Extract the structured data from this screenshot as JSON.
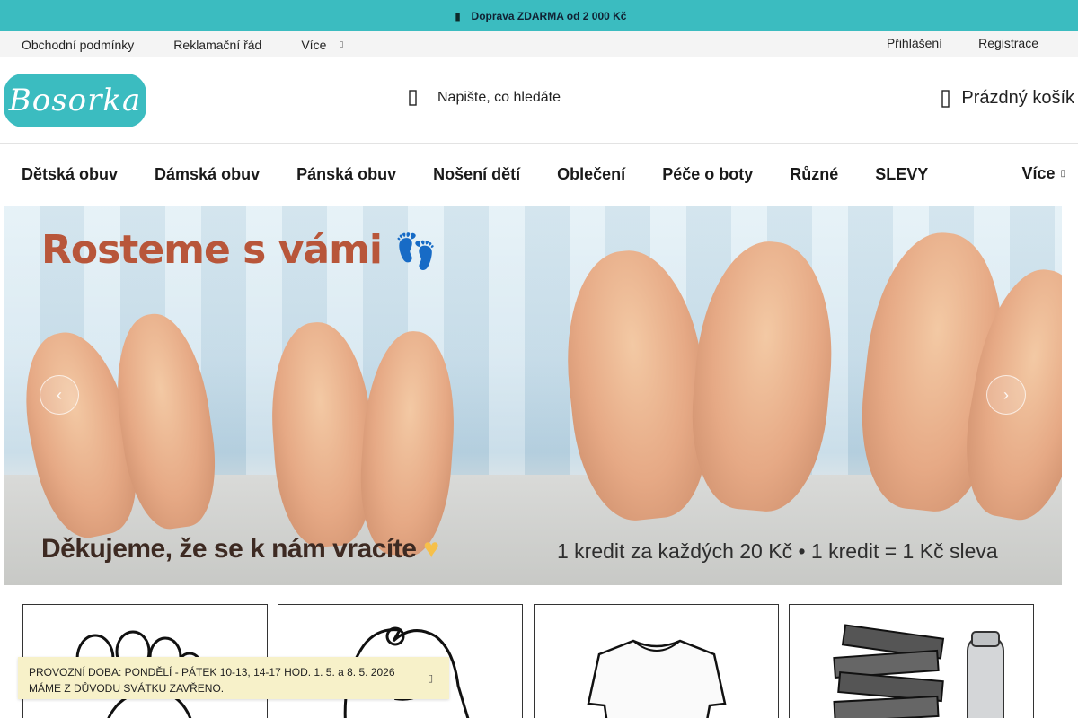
{
  "promo": {
    "text": "Doprava ZDARMA od 2 000 Kč",
    "icon": "truck-icon"
  },
  "utility": {
    "links": [
      "Obchodní podmínky",
      "Reklamační řád"
    ],
    "more_label": "Více",
    "login": "Přihlášení",
    "register": "Registrace"
  },
  "header": {
    "logo_text": "Bosorka",
    "search_label": "Napište, co hledáte",
    "cart_label": "Prázdný košík"
  },
  "categories": {
    "items": [
      "Dětská obuv",
      "Dámská obuv",
      "Pánská obuv",
      "Nošení dětí",
      "Oblečení",
      "Péče o boty",
      "Různé",
      "SLEVY"
    ],
    "more_label": "Více"
  },
  "hero": {
    "title": "Rosteme s vámi",
    "bottom_left": "Děkujeme, že se k nám vracíte",
    "bottom_right": "1 kredit za každých 20 Kč • 1 kredit = 1 Kč sleva"
  },
  "tiles": [
    "footprint-icon",
    "baby-carrier-icon",
    "tshirt-icon",
    "books-bottle-icon"
  ],
  "notice": {
    "line1": "PROVOZNÍ DOBA: PONDĚLÍ - PÁTEK 10-13, 14-17 HOD. 1. 5. a 8. 5. 2026",
    "line2": "MÁME Z DŮVODU SVÁTKU ZAVŘENO."
  },
  "colors": {
    "brand": "#3bbcc0",
    "notice_bg": "#f7f1c9",
    "hero_title": "#b8563a"
  }
}
